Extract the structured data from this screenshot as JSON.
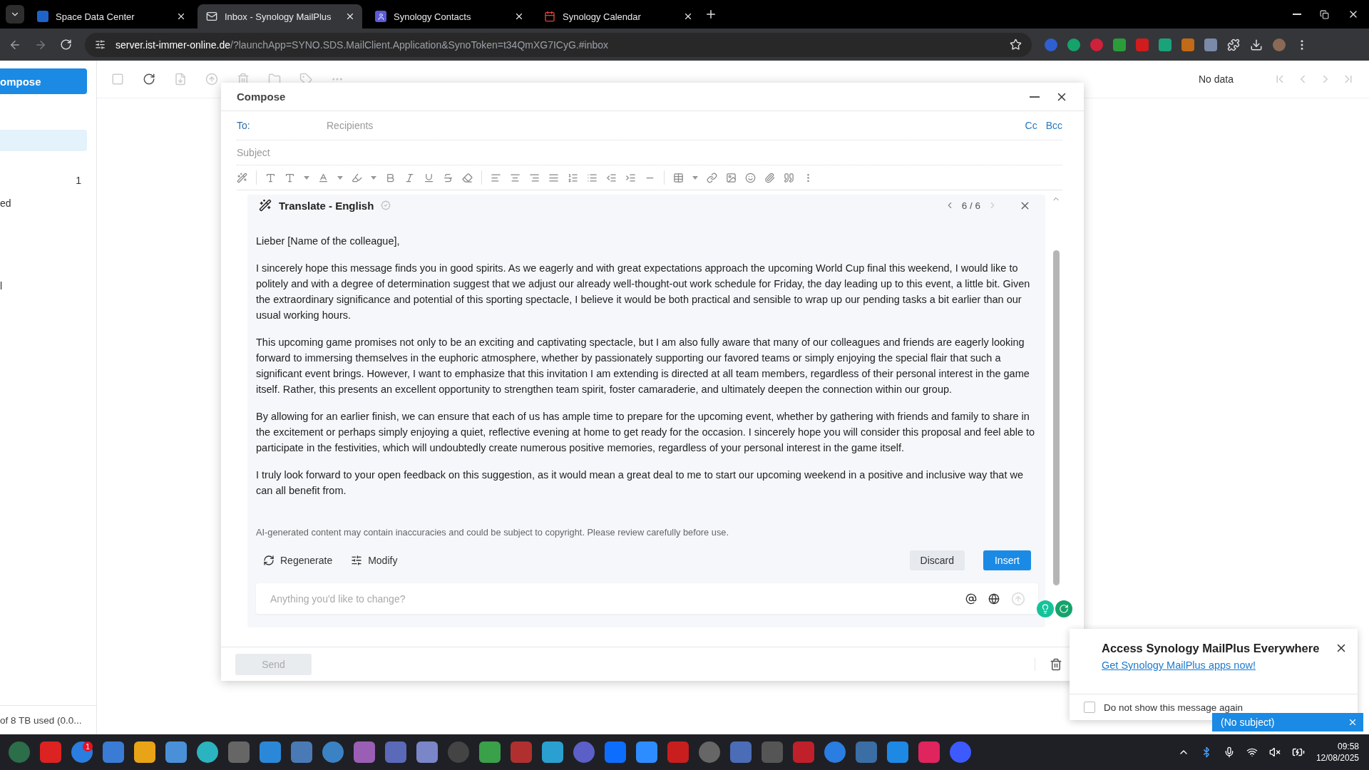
{
  "browser": {
    "tabs": [
      {
        "title": "Space Data Center",
        "kind": "dsm",
        "selected": false
      },
      {
        "title": "Inbox - Synology MailPlus",
        "kind": "mail",
        "selected": true
      },
      {
        "title": "Synology Contacts",
        "kind": "contacts",
        "selected": false
      },
      {
        "title": "Synology Calendar",
        "kind": "calendar",
        "selected": false
      }
    ],
    "url_host": "server.ist-immer-online.de",
    "url_path": "/?launchApp=SYNO.SDS.MailClient.Application&SynoToken=t34QmXG7ICyG.#inbox"
  },
  "sidebar": {
    "compose": "ompose",
    "items": [
      {
        "selected": true
      },
      {
        "count": "1",
        "selected": false
      },
      {
        "label": "ed",
        "selected": false
      },
      {
        "label": "l",
        "selected": false
      }
    ],
    "storage": "of 8 TB used (0.0..."
  },
  "mail_toolbar": {
    "status": "No data"
  },
  "compose": {
    "title": "Compose",
    "to_label": "To:",
    "recipients_placeholder": "Recipients",
    "cc": "Cc",
    "bcc": "Bcc",
    "subject_placeholder": "Subject",
    "ai": {
      "title": "Translate - English",
      "counter": "6 / 6",
      "paragraphs": [
        "Lieber [Name of the colleague],",
        "I sincerely hope this message finds you in good spirits. As we eagerly and with great expectations approach the upcoming World Cup final this weekend, I would like to politely and with a degree of determination suggest that we adjust our already well-thought-out work schedule for Friday, the day leading up to this event, a little bit. Given the extraordinary significance and potential of this sporting spectacle, I believe it would be both practical and sensible to wrap up our pending tasks a bit earlier than our usual working hours.",
        "This upcoming game promises not only to be an exciting and captivating spectacle, but I am also fully aware that many of our colleagues and friends are eagerly looking forward to immersing themselves in the euphoric atmosphere, whether by passionately supporting our favored teams or simply enjoying the special flair that such a significant event brings. However, I want to emphasize that this invitation I am extending is directed at all team members, regardless of their personal interest in the game itself. Rather, this presents an excellent opportunity to strengthen team spirit, foster camaraderie, and ultimately deepen the connection within our group.",
        "By allowing for an earlier finish, we can ensure that each of us has ample time to prepare for the upcoming event, whether by gathering with friends and family to share in the excitement or perhaps simply enjoying a quiet, reflective evening at home to get ready for the occasion. I sincerely hope you will consider this proposal and feel able to participate in the festivities, which will undoubtedly create numerous positive memories, regardless of your personal interest in the game itself.",
        "I truly look forward to your open feedback on this suggestion, as it would mean a great deal to me to start our upcoming weekend in a positive and inclusive way that we can all benefit from."
      ],
      "disclaimer": "AI-generated content may contain inaccuracies and could be subject to copyright. Please review carefully before use.",
      "actions": [
        {
          "label": "Regenerate",
          "kind": "regenerate"
        },
        {
          "label": "Modify",
          "kind": "modify"
        }
      ],
      "discard": "Discard",
      "insert": "Insert",
      "prompt_placeholder": "Anything you'd like to change?"
    },
    "send": {
      "label": "Send",
      "disabled": true
    }
  },
  "notification": {
    "title": "Access Synology MailPlus Everywhere",
    "link": "Get Synology MailPlus apps now!",
    "checkbox": {
      "label": "Do not show this message again",
      "checked": false
    }
  },
  "minimized": {
    "title": "(No subject)"
  },
  "taskbar": {
    "badge": "1",
    "time": "09:58",
    "date": "12/08/2025"
  }
}
